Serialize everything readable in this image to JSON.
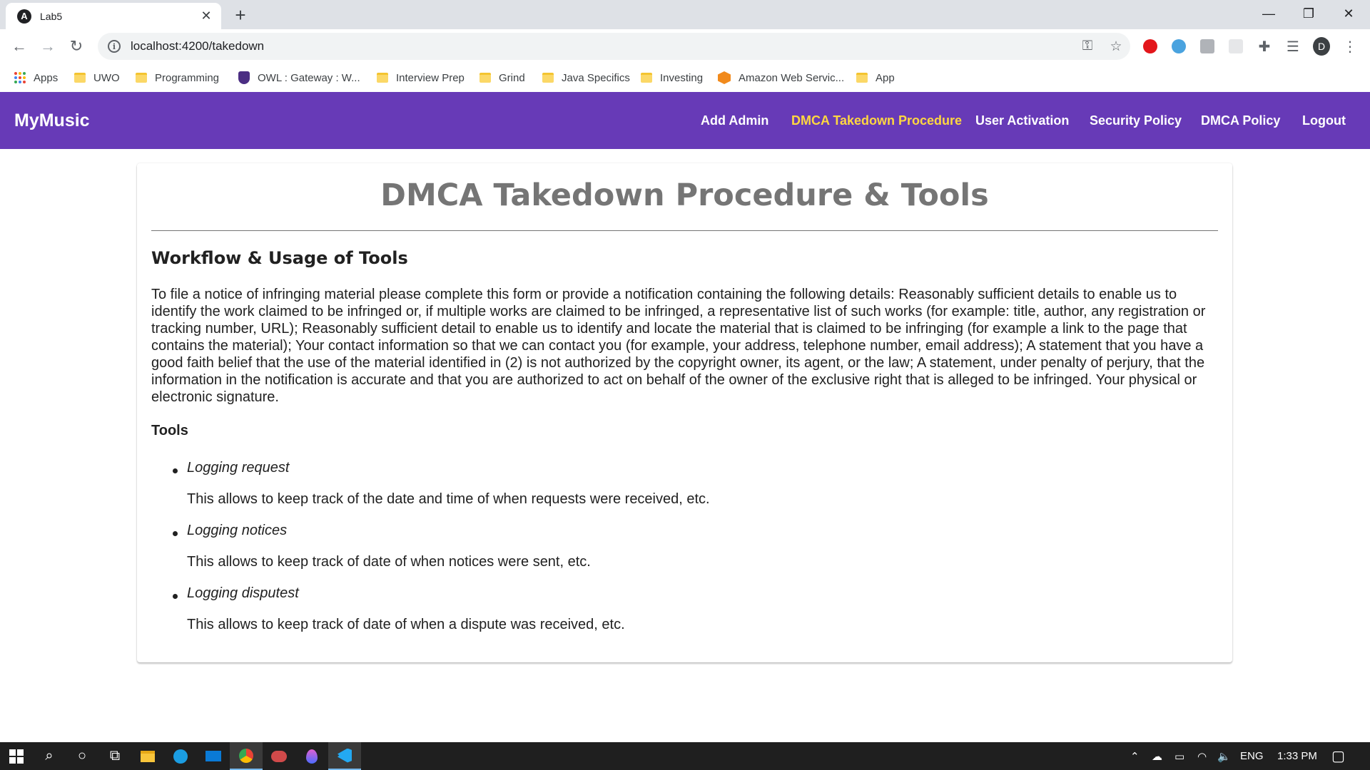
{
  "browser": {
    "tab_title": "Lab5",
    "tab_favicon": "angular-icon",
    "url": "localhost:4200/takedown",
    "profile_initial": "D"
  },
  "bookmarks": [
    {
      "label": "Apps",
      "icon": "apps-grid-icon"
    },
    {
      "label": "UWO",
      "icon": "folder-icon"
    },
    {
      "label": "Programming",
      "icon": "folder-icon"
    },
    {
      "label": "OWL : Gateway : W...",
      "icon": "shield-icon"
    },
    {
      "label": "Interview Prep",
      "icon": "folder-icon"
    },
    {
      "label": "Grind",
      "icon": "folder-icon"
    },
    {
      "label": "Java Specifics",
      "icon": "folder-icon"
    },
    {
      "label": "Investing",
      "icon": "folder-icon"
    },
    {
      "label": "Amazon Web Servic...",
      "icon": "aws-cube-icon"
    },
    {
      "label": "App",
      "icon": "folder-icon"
    }
  ],
  "app": {
    "brand": "MyMusic",
    "nav": [
      {
        "label": "Add Admin",
        "active": false
      },
      {
        "label": "DMCA Takedown Procedure",
        "active": true
      },
      {
        "label": "User Activation",
        "active": false
      },
      {
        "label": "Security Policy",
        "active": false
      },
      {
        "label": "DMCA Policy",
        "active": false
      },
      {
        "label": "Logout",
        "active": false
      }
    ],
    "accent_color": "#673ab7",
    "active_link_color": "#ffd740"
  },
  "content": {
    "title": "DMCA Takedown Procedure & Tools",
    "section_heading": "Workflow & Usage of Tools",
    "paragraph": "To file a notice of infringing material please complete this form or provide a notification containing the following details: Reasonably sufficient details to enable us to identify the work claimed to be infringed or, if multiple works are claimed to be infringed, a representative list of such works (for example: title, author, any registration or tracking number, URL); Reasonably sufficient detail to enable us to identify and locate the material that is claimed to be infringing (for example a link to the page that contains the material); Your contact information so that we can contact you (for example, your address, telephone number, email address); A statement that you have a good faith belief that the use of the material identified in (2) is not authorized by the copyright owner, its agent, or the law; A statement, under penalty of perjury, that the information in the notification is accurate and that you are authorized to act on behalf of the owner of the exclusive right that is alleged to be infringed. Your physical or electronic signature.",
    "tools_heading": "Tools",
    "tools": [
      {
        "name": "Logging request",
        "description": "This allows to keep track of the date and time of when requests were received, etc."
      },
      {
        "name": "Logging notices",
        "description": "This allows to keep track of date of when notices were sent, etc."
      },
      {
        "name": "Logging disputest",
        "description": "This allows to keep track of date of when a dispute was received, etc."
      }
    ]
  },
  "taskbar": {
    "language": "ENG",
    "time": "1:33 PM"
  }
}
